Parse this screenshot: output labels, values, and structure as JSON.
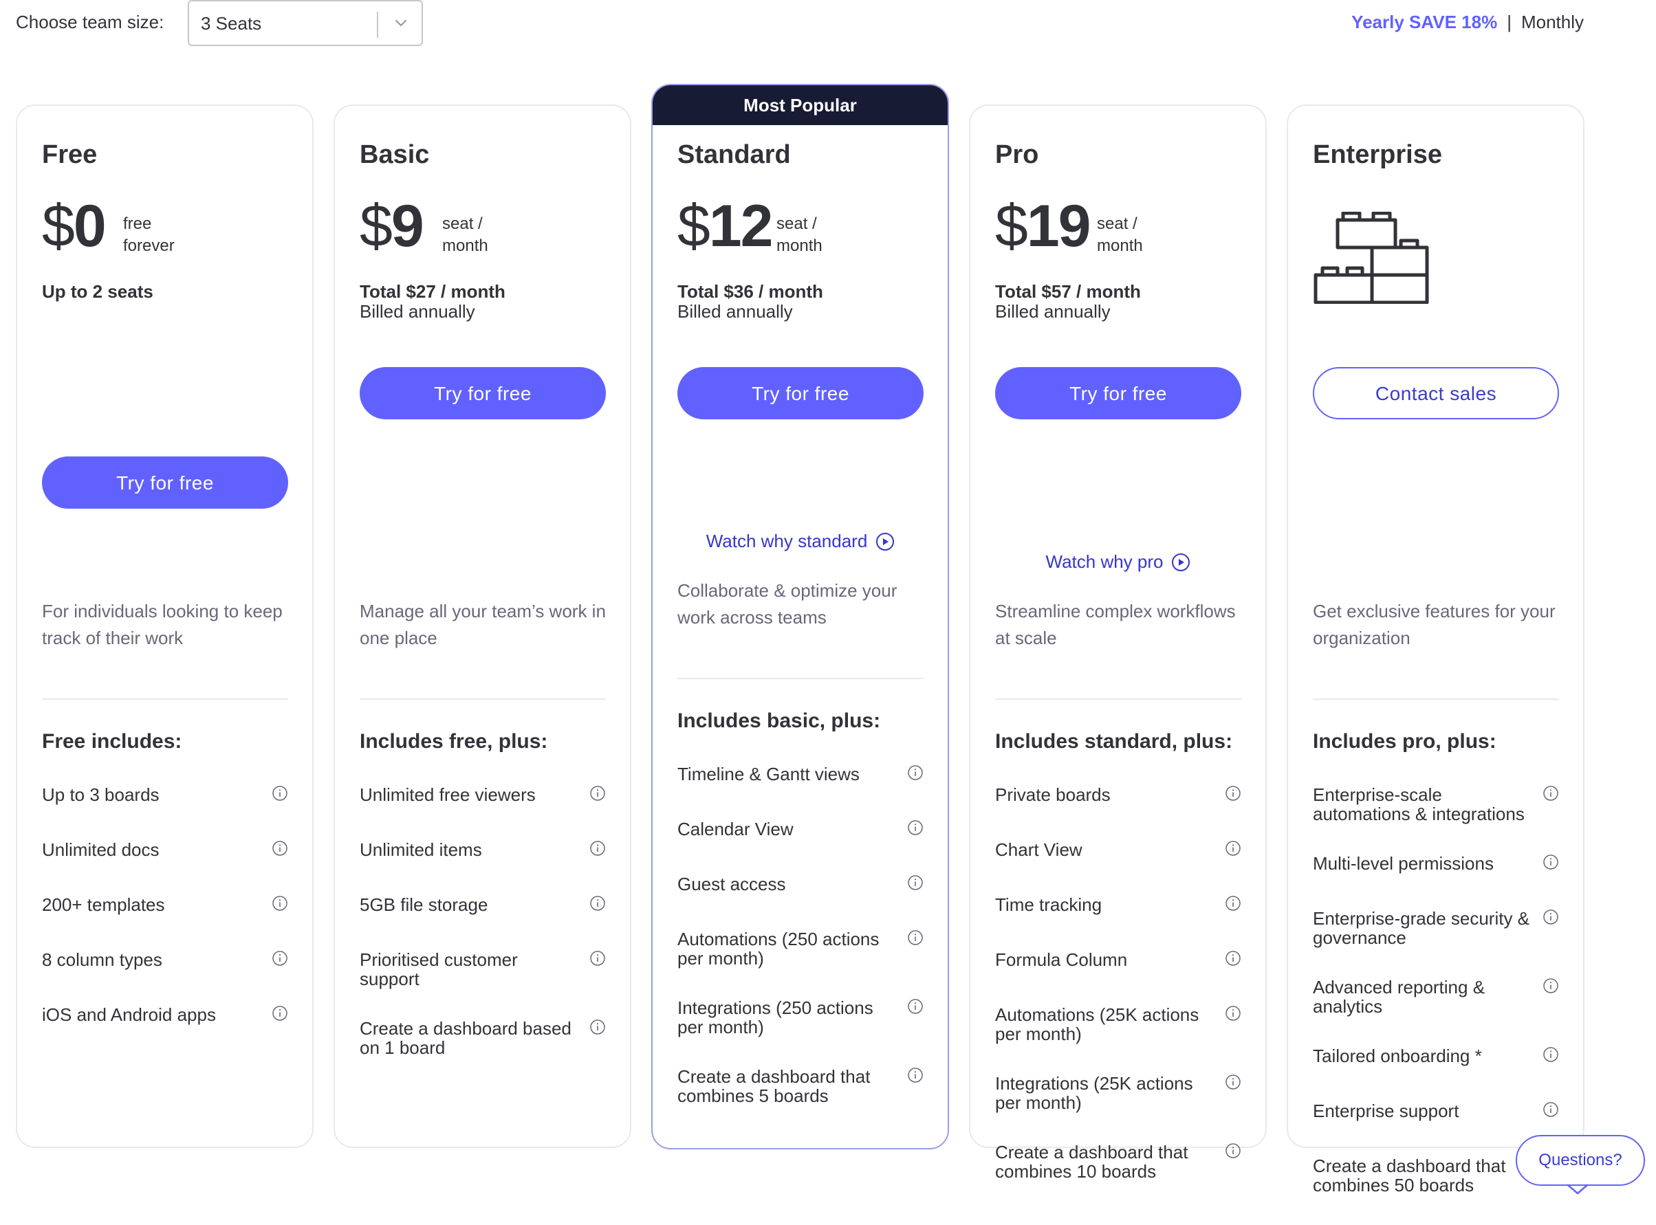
{
  "team_size": {
    "label": "Choose team size:",
    "value": "3 Seats"
  },
  "billing": {
    "yearly": "Yearly",
    "save": "SAVE 18%",
    "separator": "|",
    "monthly": "Monthly"
  },
  "accent_color": "#6161ff",
  "plans": [
    {
      "name": "Free",
      "currency": "$",
      "price": "0",
      "unit": "free forever",
      "total": "Up to 2 seats",
      "billed": "",
      "cta": "Try for free",
      "watch": "",
      "description": "For individuals looking to keep track of their work",
      "includes_title": "Free includes:",
      "features": [
        "Up to 3 boards",
        "Unlimited docs",
        "200+ templates",
        "8 column types",
        "iOS and Android apps"
      ]
    },
    {
      "name": "Basic",
      "currency": "$",
      "price": "9",
      "unit": "seat / month",
      "total": "Total $27 / month",
      "billed": "Billed annually",
      "cta": "Try for free",
      "watch": "",
      "description": "Manage all your team’s work in one place",
      "includes_title": "Includes free, plus:",
      "features": [
        "Unlimited free viewers",
        "Unlimited items",
        "5GB file storage",
        "Prioritised customer support",
        "Create a dashboard based on 1 board"
      ]
    },
    {
      "name": "Standard",
      "badge": "Most Popular",
      "currency": "$",
      "price": "12",
      "unit": "seat / month",
      "total": "Total $36 / month",
      "billed": "Billed annually",
      "cta": "Try for free",
      "watch": "Watch why standard",
      "description": "Collaborate & optimize your work across teams",
      "includes_title": "Includes basic, plus:",
      "features": [
        "Timeline & Gantt views",
        "Calendar View",
        "Guest access",
        "Automations (250 actions per month)",
        "Integrations (250 actions per month)",
        "Create a dashboard that combines 5 boards"
      ]
    },
    {
      "name": "Pro",
      "currency": "$",
      "price": "19",
      "unit": "seat / month",
      "total": "Total $57 / month",
      "billed": "Billed annually",
      "cta": "Try for free",
      "watch": "Watch why pro",
      "description": "Streamline complex workflows at scale",
      "includes_title": "Includes standard, plus:",
      "features": [
        "Private boards",
        "Chart View",
        "Time tracking",
        "Formula Column",
        "Automations (25K actions per month)",
        "Integrations (25K actions per month)",
        "Create a dashboard that combines 10 boards"
      ]
    },
    {
      "name": "Enterprise",
      "cta": "Contact sales",
      "description": "Get exclusive features for your organization",
      "includes_title": "Includes pro, plus:",
      "features": [
        "Enterprise-scale automations & integrations",
        "Multi-level permissions",
        "Enterprise-grade security & governance",
        "Advanced reporting & analytics",
        "Tailored onboarding *",
        "Enterprise support",
        "Create a dashboard that combines 50 boards"
      ]
    }
  ],
  "questions_label": "Questions?"
}
